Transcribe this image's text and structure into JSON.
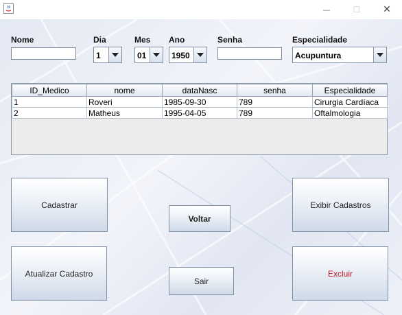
{
  "window": {
    "minimize_glyph": "—",
    "maximize_glyph": "☐",
    "close_glyph": "✕"
  },
  "form": {
    "nome": {
      "label": "Nome",
      "value": ""
    },
    "dia": {
      "label": "Dia",
      "value": "1"
    },
    "mes": {
      "label": "Mes",
      "value": "01"
    },
    "ano": {
      "label": "Ano",
      "value": "1950"
    },
    "senha": {
      "label": "Senha",
      "value": ""
    },
    "especialidade": {
      "label": "Especialidade",
      "value": "Acupuntura"
    }
  },
  "table": {
    "columns": [
      "ID_Medico",
      "nome",
      "dataNasc",
      "senha",
      "Especialidade"
    ],
    "rows": [
      [
        "1",
        "Roveri",
        "1985-09-30",
        "789",
        "Cirurgia Cardíaca"
      ],
      [
        "2",
        "Matheus",
        "1995-04-05",
        "789",
        "Oftalmologia"
      ]
    ]
  },
  "buttons": {
    "cadastrar": "Cadastrar",
    "voltar": "Voltar",
    "exibir": "Exibir Cadastros",
    "atualizar": "Atualizar Cadastro",
    "sair": "Sair",
    "excluir": "Excluir"
  },
  "colors": {
    "excluir_text": "#c0141e"
  }
}
